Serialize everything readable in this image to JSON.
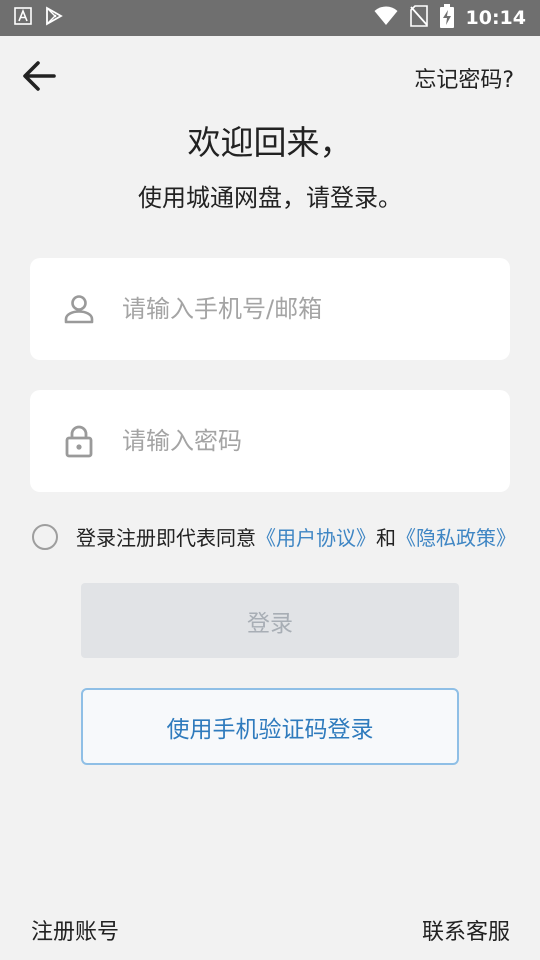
{
  "status_bar": {
    "time": "10:14",
    "left_icons": [
      "a-notification-icon",
      "play-store-icon"
    ],
    "right_icons": [
      "wifi-icon",
      "no-sim-icon",
      "battery-charging-icon"
    ]
  },
  "nav": {
    "back_icon": "arrow-left-icon",
    "forgot_password": "忘记密码?"
  },
  "welcome": {
    "title": "欢迎回来，",
    "subtitle": "使用城通网盘，请登录。"
  },
  "form": {
    "phone_placeholder": "请输入手机号/邮箱",
    "phone_value": "",
    "password_placeholder": "请输入密码",
    "password_value": ""
  },
  "agreement": {
    "checked": false,
    "prefix": "登录注册即代表同意",
    "user_agreement": "《用户协议》",
    "and": "和",
    "privacy_policy": "《隐私政策》"
  },
  "buttons": {
    "login": "登录",
    "sms_login": "使用手机验证码登录"
  },
  "footer": {
    "register": "注册账号",
    "contact": "联系客服"
  },
  "colors": {
    "link": "#3f86c4",
    "sms_border": "#8fbfe6",
    "login_disabled_bg": "#e1e3e6",
    "status_bar_bg": "#6f6f6f",
    "page_bg": "#f2f2f2"
  }
}
